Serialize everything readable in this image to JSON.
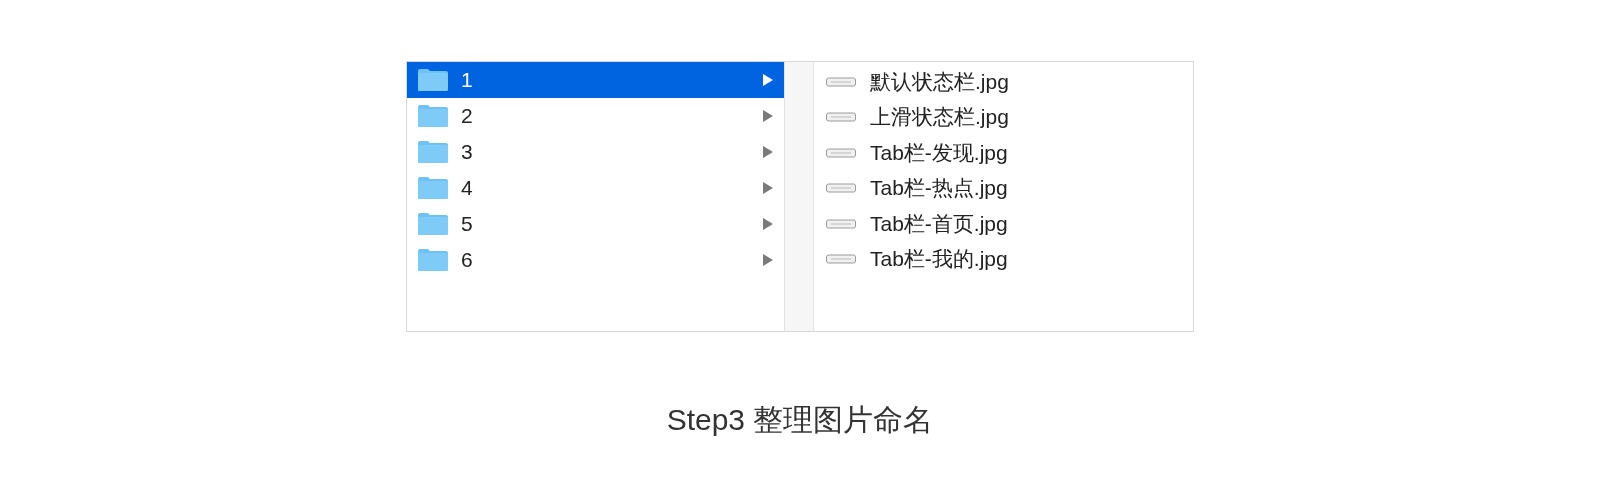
{
  "folders": [
    {
      "name": "1",
      "selected": true
    },
    {
      "name": "2",
      "selected": false
    },
    {
      "name": "3",
      "selected": false
    },
    {
      "name": "4",
      "selected": false
    },
    {
      "name": "5",
      "selected": false
    },
    {
      "name": "6",
      "selected": false
    }
  ],
  "files": [
    {
      "name": "默认状态栏.jpg"
    },
    {
      "name": "上滑状态栏.jpg"
    },
    {
      "name": "Tab栏-发现.jpg"
    },
    {
      "name": "Tab栏-热点.jpg"
    },
    {
      "name": "Tab栏-首页.jpg"
    },
    {
      "name": "Tab栏-我的.jpg"
    }
  ],
  "caption": "Step3 整理图片命名"
}
